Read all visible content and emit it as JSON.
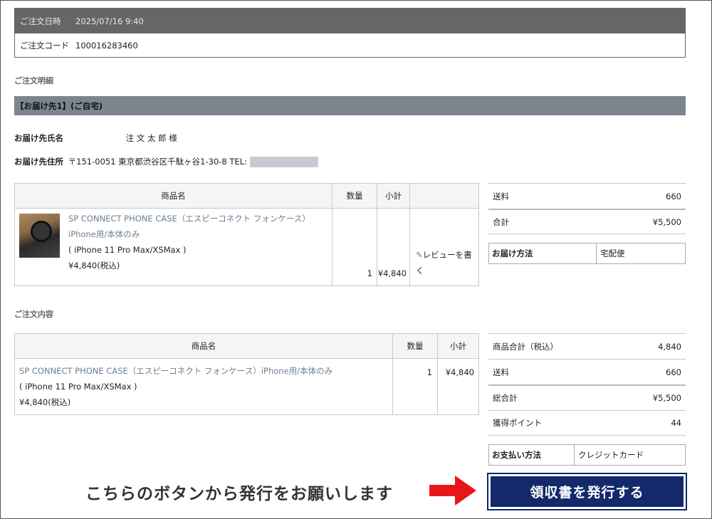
{
  "order": {
    "date_label": "ご注文日時",
    "date_value": "2025/07/16 9:40",
    "code_label": "ご注文コード",
    "code_value": "100016283460"
  },
  "details": {
    "section_title": "ご注文明細",
    "destination_bar": "【お届け先1】(ご自宅)",
    "name_label": "お届け先氏名",
    "name_value": "注 文 太 郎 様",
    "address_label": "お届け先住所",
    "address_value": "〒151-0051 東京都渋谷区千駄ヶ谷1-30-8 TEL:",
    "table": {
      "col_name": "商品名",
      "col_qty": "数量",
      "col_subtotal": "小計",
      "product_name": "SP CONNECT PHONE CASE（エスピーコネクト フォンケース）iPhone用/本体のみ",
      "product_variant": "( iPhone 11 Pro Max/XSMax )",
      "product_price": "¥4,840(税込)",
      "qty": "1",
      "subtotal": "¥4,840",
      "review_link": "レビューを書く"
    },
    "summary": {
      "shipping_label": "送料",
      "shipping_value": "660",
      "total_label": "合計",
      "total_value": "¥5,500",
      "delivery_label": "お届け方法",
      "delivery_value": "宅配便"
    }
  },
  "contents": {
    "section_title": "ご注文内容",
    "table": {
      "col_name": "商品名",
      "col_qty": "数量",
      "col_subtotal": "小計",
      "product_name": "SP CONNECT PHONE CASE（エスピーコネクト フォンケース）iPhone用/本体のみ",
      "product_variant": "( iPhone 11 Pro Max/XSMax )",
      "product_price": "¥4,840(税込)",
      "qty": "1",
      "subtotal": "¥4,840"
    },
    "summary": {
      "items_total_label": "商品合計（税込）",
      "items_total_value": "4,840",
      "shipping_label": "送料",
      "shipping_value": "660",
      "grand_total_label": "総合計",
      "grand_total_value": "¥5,500",
      "points_label": "獲得ポイント",
      "points_value": "44",
      "payment_label": "お支払い方法",
      "payment_value": "クレジットカード"
    }
  },
  "receipt_button": "領収書を発行する",
  "callout_text": "こちらのボタンから発行をお願いします",
  "icons": [
    "pencil-icon",
    "arrow-right-icon",
    "product-thumbnail"
  ],
  "colors": {
    "header_gray": "#666666",
    "bar_gray": "#7c858e",
    "button_navy": "#13296b",
    "arrow_red": "#e8161b",
    "link": "#6b7f93"
  }
}
